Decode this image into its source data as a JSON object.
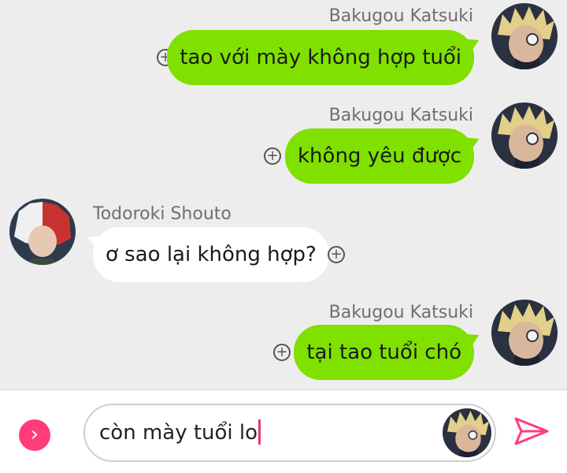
{
  "messages": [
    {
      "sender": "Bakugou Katsuki",
      "text": "tao với mày không hợp tuổi",
      "side": "right"
    },
    {
      "sender": "Bakugou Katsuki",
      "text": "không yêu được",
      "side": "right"
    },
    {
      "sender": "Todoroki Shouto",
      "text": "ơ sao lại không hợp?",
      "side": "left"
    },
    {
      "sender": "Bakugou Katsuki",
      "text": "tại tao tuổi chó",
      "side": "right"
    }
  ],
  "composer": {
    "input_value": "còn mày tuổi lo",
    "expand_icon": "chevron-right-icon",
    "send_icon": "send-icon"
  },
  "colors": {
    "own_bubble": "#80e000",
    "other_bubble": "#ffffff",
    "accent": "#ff3c78",
    "background": "#ededed"
  }
}
